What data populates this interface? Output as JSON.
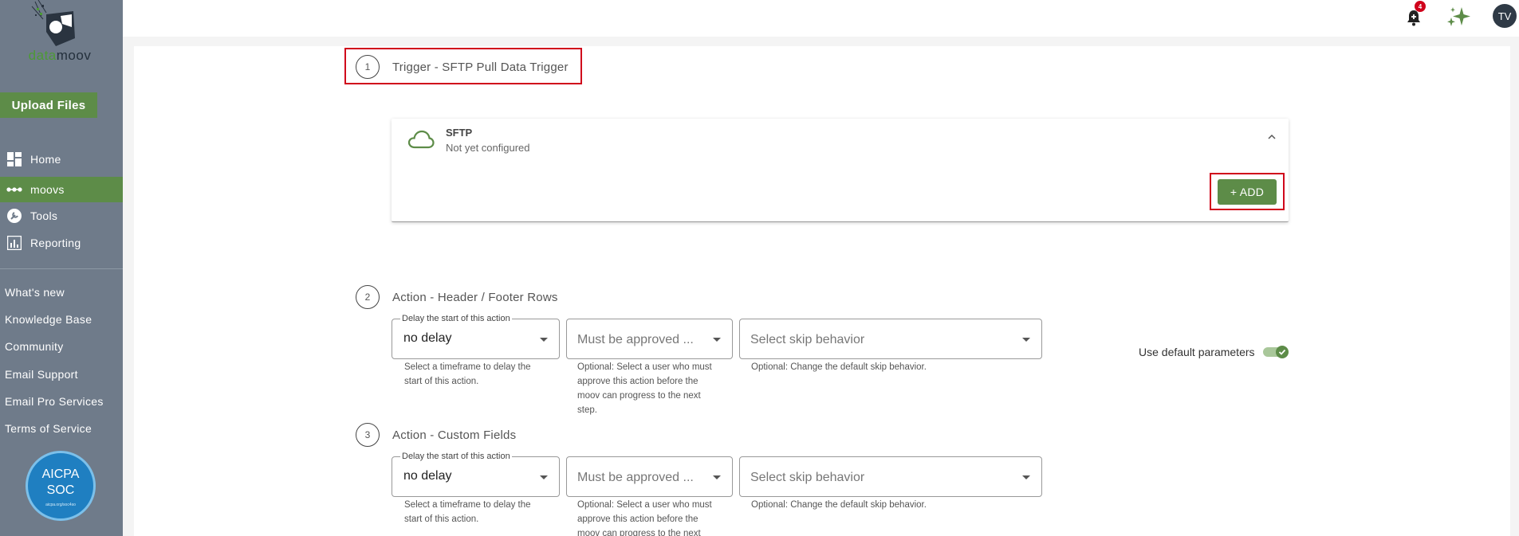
{
  "sidebar": {
    "logo_text_left": "data",
    "logo_text_right": "moov",
    "upload_label": "Upload Files",
    "nav": [
      {
        "label": "Home",
        "icon": "dashboard-icon"
      },
      {
        "label": "moovs",
        "icon": "nodes-icon",
        "active": true
      },
      {
        "label": "Tools",
        "icon": "wrench-icon"
      },
      {
        "label": "Reporting",
        "icon": "bar-chart-icon"
      }
    ],
    "links": [
      "What's new",
      "Knowledge Base",
      "Community",
      "Email Support",
      "Email Pro Services",
      "Terms of Service"
    ],
    "badge": {
      "line1": "AICPA",
      "line2": "SOC",
      "line3": "aicpa.org/soc4so"
    }
  },
  "topbar": {
    "notification_count": "4",
    "avatar_initials": "TV"
  },
  "steps": [
    {
      "number": "1",
      "title": "Trigger - SFTP Pull Data Trigger"
    },
    {
      "number": "2",
      "title": "Action - Header / Footer Rows"
    },
    {
      "number": "3",
      "title": "Action - Custom Fields"
    }
  ],
  "trigger_card": {
    "title": "SFTP",
    "subtitle": "Not yet configured",
    "add_label": "+ ADD"
  },
  "action_fields": {
    "delay_legend": "Delay the start of this action",
    "delay_value": "no delay",
    "delay_help": "Select a timeframe to delay the start of this action.",
    "approver_placeholder": "Must be approved ...",
    "approver_help": "Optional: Select a user who must approve this action before the moov can progress to the next step.",
    "skip_placeholder": "Select skip behavior",
    "skip_help": "Optional: Change the default skip behavior."
  },
  "default_params_label": "Use default parameters",
  "colors": {
    "brand_green": "#5d8c48",
    "sidebar": "#6f7b8a",
    "highlight_red": "#d0021b"
  }
}
